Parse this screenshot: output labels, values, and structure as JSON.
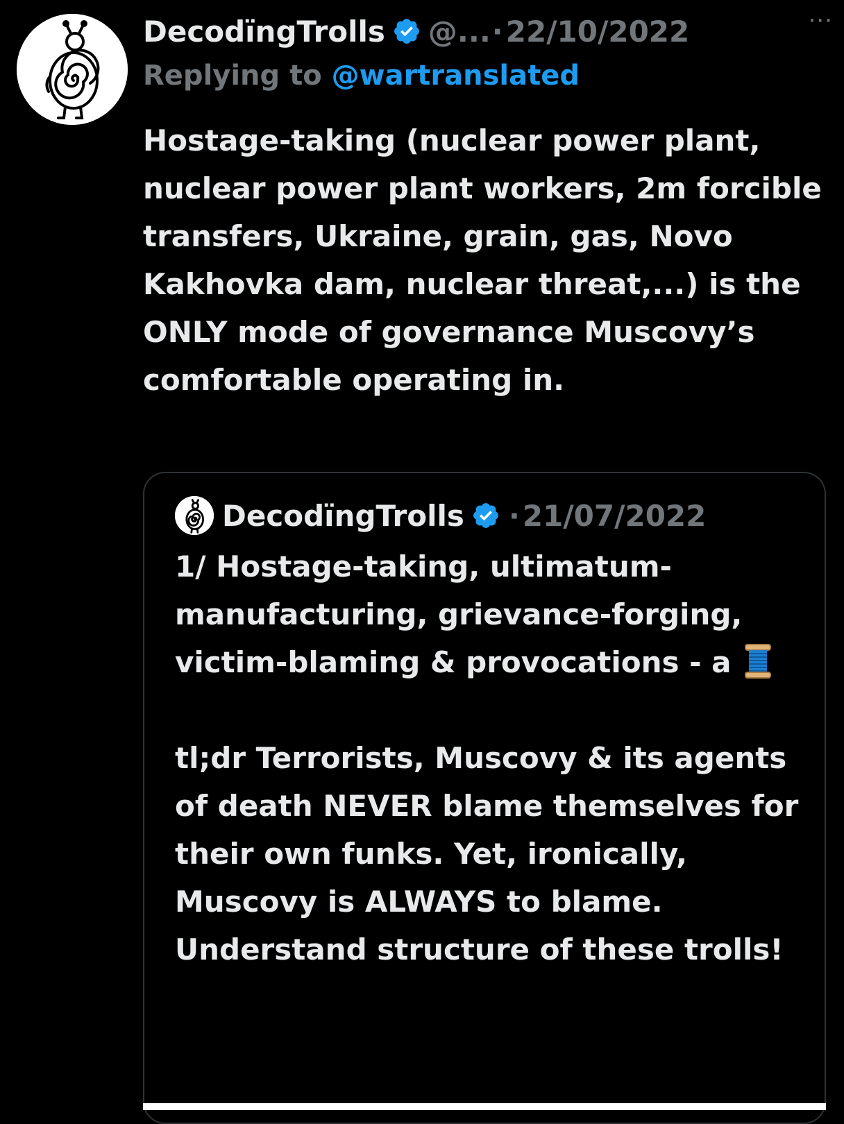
{
  "tweet": {
    "author": {
      "display_name": "DecodïngTrolls",
      "handle": "@...",
      "avatar_icon": "spiral-figure-avatar-icon",
      "verified_icon": "verified-badge-icon"
    },
    "separator": "·",
    "date": "22/10/2022",
    "more_label": "···",
    "replying_to": {
      "prefix": "Replying to ",
      "mention": "@wartranslated"
    },
    "text": "Hostage-taking (nuclear power plant, nuclear power plant workers, 2m forcible transfers, Ukraine, grain, gas, Novo Kakhovka dam, nuclear threat,...) is the ONLY mode of governance Muscovy’s comfortable operating in."
  },
  "quoted_tweet": {
    "author": {
      "display_name": "DecodïngTrolls",
      "avatar_icon": "spiral-figure-avatar-icon",
      "verified_icon": "verified-badge-icon"
    },
    "separator": "·",
    "date": "21/07/2022",
    "text_part1": "1/ Hostage-taking, ultimatum-manufacturing, grievance-forging, victim-blaming & provocations - a",
    "emoji_icon": "spool-of-thread-icon",
    "text_part2": "tl;dr Terrorists, Muscovy & its agents of death NEVER blame themselves for their own funks. Yet, ironically, Muscovy is ALWAYS to blame. Understand structure of these trolls!"
  },
  "colors": {
    "background": "#000000",
    "text_primary": "#e7e9ea",
    "text_secondary": "#71767b",
    "link": "#1d9bf0",
    "verified": "#1d9bf0",
    "border": "#2f3336"
  }
}
